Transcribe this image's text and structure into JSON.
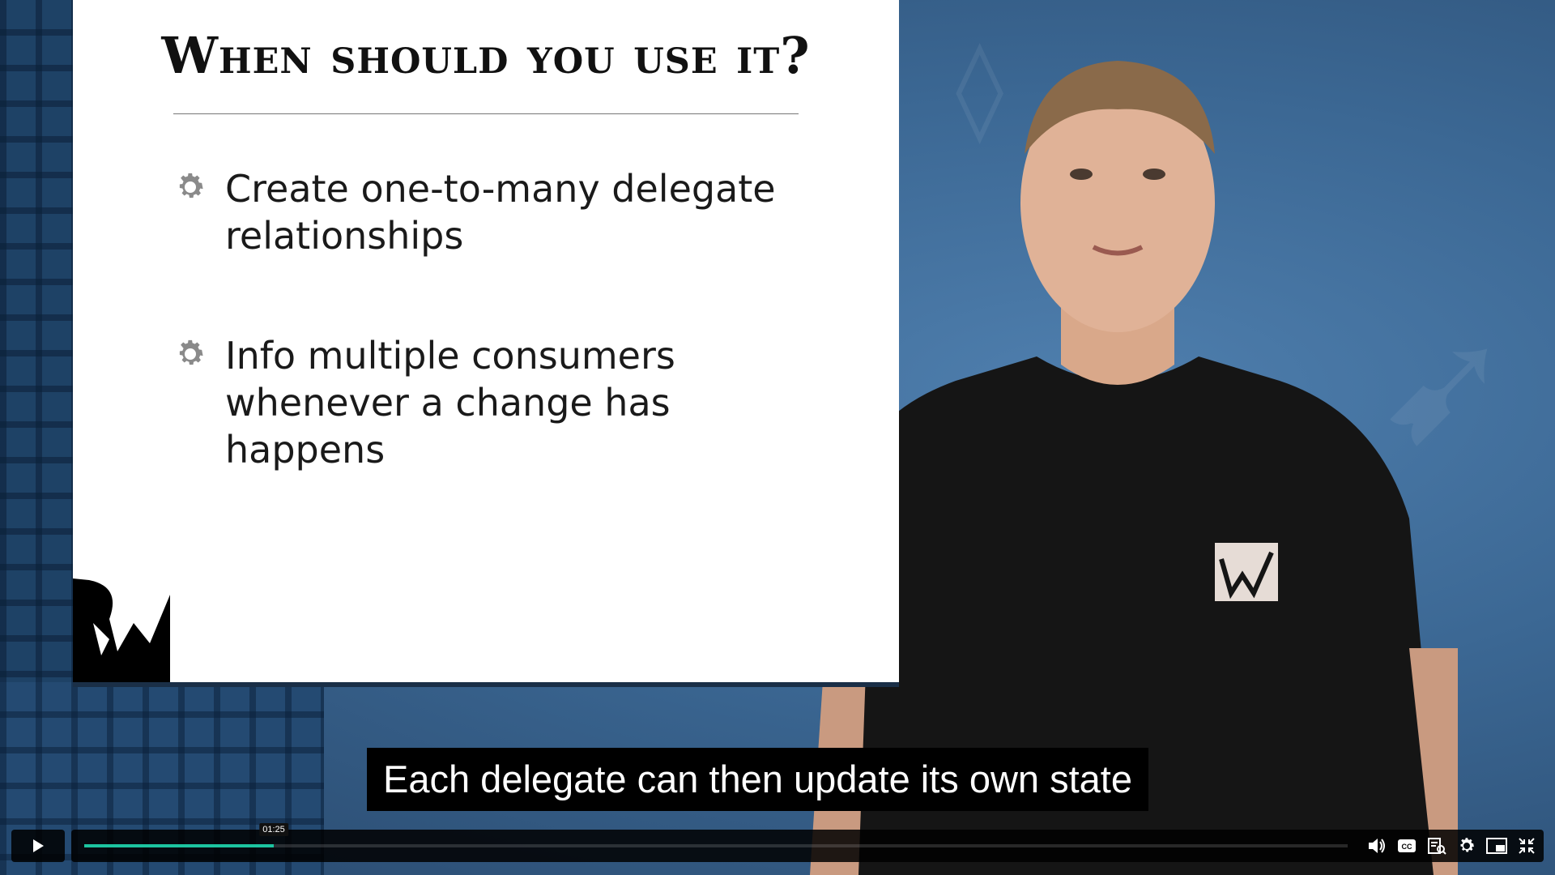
{
  "slide": {
    "title": "When should you use it?",
    "bullets": [
      {
        "text": "Create one-to-many delegate relationships"
      },
      {
        "text": "Info multiple consumers whenever a change has happens"
      }
    ]
  },
  "caption": {
    "text": "Each delegate can then update its own state"
  },
  "player": {
    "current_time": "01:25",
    "progress": 0.15,
    "accent_color": "#1cc4a0",
    "icons": [
      "play-icon",
      "volume-icon",
      "captions-icon",
      "transcript-icon",
      "settings-icon",
      "picture-in-picture-icon",
      "exit-fullscreen-icon"
    ]
  }
}
